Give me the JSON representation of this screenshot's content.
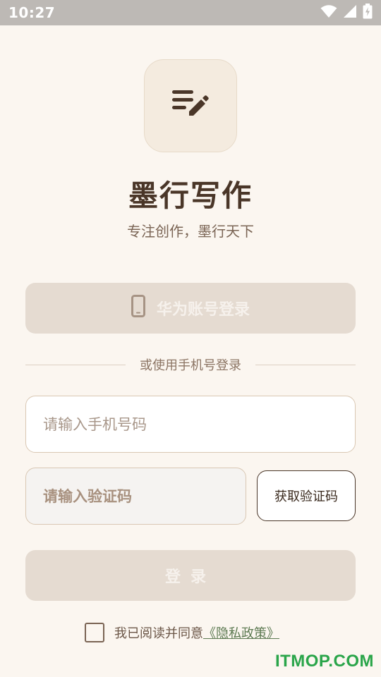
{
  "status_bar": {
    "time": "10:27",
    "icons": [
      "wifi-icon",
      "signal-icon",
      "battery-charging-icon"
    ]
  },
  "app": {
    "icon": "edit-list-icon",
    "title": "墨行写作",
    "slogan": "专注创作，墨行天下"
  },
  "huawei_login": {
    "icon": "phone-icon",
    "label": "华为账号登录"
  },
  "divider": {
    "text": "或使用手机号登录"
  },
  "phone_field": {
    "value": "",
    "placeholder": "请输入手机号码"
  },
  "code_field": {
    "value": "",
    "placeholder": "请输入验证码"
  },
  "get_code": {
    "label": "获取验证码"
  },
  "login": {
    "label": "登录"
  },
  "agreement": {
    "checked": false,
    "text": "我已阅读并同意",
    "link": "《隐私政策》"
  },
  "watermark": "ITMOP.COM",
  "colors": {
    "background": "#fbf6f0",
    "primary_text": "#4a3628",
    "disabled_button": "#e5dbd1",
    "link": "#5d7a52",
    "watermark": "#2aa54a"
  }
}
